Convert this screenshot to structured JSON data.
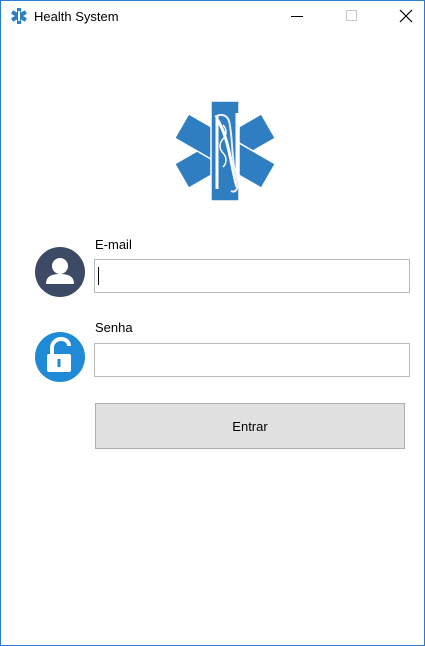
{
  "window": {
    "title": "Health System",
    "controls": {
      "minimize_icon": "minimize-icon",
      "maximize_icon": "maximize-icon",
      "close_icon": "close-icon"
    }
  },
  "logo": {
    "icon": "star-of-life-logo",
    "color": "#2f7ec1"
  },
  "form": {
    "email": {
      "label": "E-mail",
      "value": "",
      "placeholder": "",
      "icon": "user-icon"
    },
    "senha": {
      "label": "Senha",
      "value": "",
      "placeholder": "",
      "icon": "unlock-icon"
    },
    "submit_label": "Entrar"
  },
  "colors": {
    "accent": "#2b79d0",
    "user_icon_bg": "#3c4a66",
    "lock_icon_bg": "#1f8ad6",
    "button_bg": "#e1e1e1"
  }
}
